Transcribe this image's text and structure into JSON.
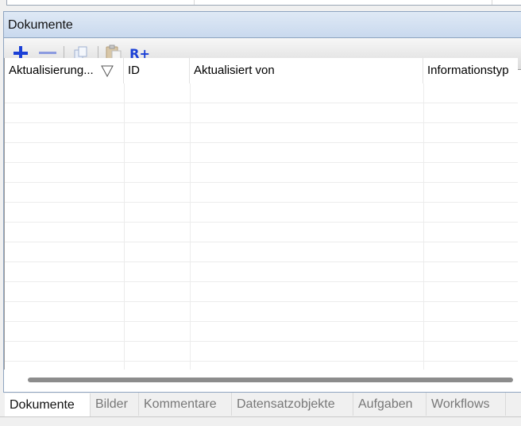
{
  "panel": {
    "title": "Dokumente"
  },
  "toolbar": {
    "add_icon": "plus-icon",
    "remove_icon": "minus-icon",
    "copy_icon": "copy-icon",
    "paste_icon": "paste-icon",
    "record_add_label": "R+"
  },
  "grid": {
    "columns": [
      {
        "label": "Aktualisierung...",
        "sorted": "descending"
      },
      {
        "label": "ID"
      },
      {
        "label": "Aktualisiert von"
      },
      {
        "label": "Informationstyp"
      }
    ],
    "rows": []
  },
  "tabs": [
    {
      "label": "Dokumente",
      "active": true
    },
    {
      "label": "Bilder"
    },
    {
      "label": "Kommentare"
    },
    {
      "label": "Datensatzobjekte"
    },
    {
      "label": "Aufgaben"
    },
    {
      "label": "Workflows"
    }
  ],
  "colors": {
    "accent": "#1a3fd6",
    "header_bg": "#c9d9ee"
  }
}
